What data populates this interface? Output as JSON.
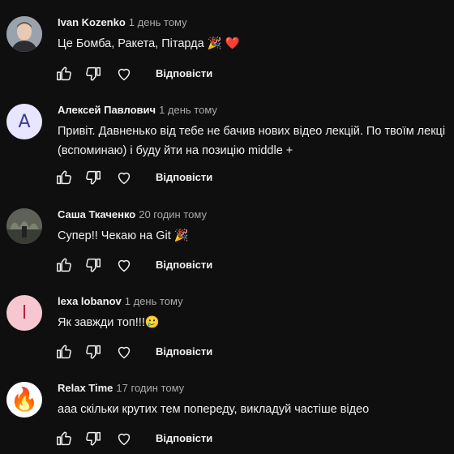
{
  "comments": [
    {
      "author": "Ivan Kozenko",
      "time": "1 день тому",
      "text_lines": [
        "Це Бомба, Ракета, Пітарда 🎉 ❤️"
      ],
      "avatar": {
        "type": "photo",
        "bg": "#8a96a0"
      },
      "reply_label": "Відповісти"
    },
    {
      "author": "Алексей Павлович",
      "time": "1 день тому",
      "text_lines": [
        "Привіт. Давненько від тебе не бачив нових відео лекцій. По твоїм лекці",
        "(вспоминаю) і буду йти на позицію middle +"
      ],
      "avatar": {
        "type": "letter",
        "letter": "A",
        "bg": "#e8e6ff",
        "fg": "#3b3b8f"
      },
      "reply_label": "Відповісти"
    },
    {
      "author": "Саша Ткаченко",
      "time": "20 годин тому",
      "text_lines": [
        "Супер!! Чекаю на Git 🎉"
      ],
      "avatar": {
        "type": "photo",
        "bg": "#4a4f44"
      },
      "reply_label": "Відповісти"
    },
    {
      "author": "lexa lobanov",
      "time": "1 день тому",
      "text_lines": [
        "Як завжди топ!!!🥲"
      ],
      "avatar": {
        "type": "letter",
        "letter": "l",
        "bg": "#f6c7d1",
        "fg": "#b0203e"
      },
      "reply_label": "Відповісти"
    },
    {
      "author": "Relax Time",
      "time": "17 годин тому",
      "text_lines": [
        "ааа скільки крутих тем попереду, викладуй частіше відео"
      ],
      "avatar": {
        "type": "emoji",
        "emoji": "🔥",
        "bg": "#ffffff"
      },
      "reply_label": "Відповісти"
    }
  ],
  "icons": {
    "like": "thumbs-up-icon",
    "dislike": "thumbs-down-icon",
    "heart": "heart-icon"
  },
  "colors": {
    "background": "#0f0f0f",
    "text": "#f1f1f1",
    "muted": "#aaaaaa"
  }
}
